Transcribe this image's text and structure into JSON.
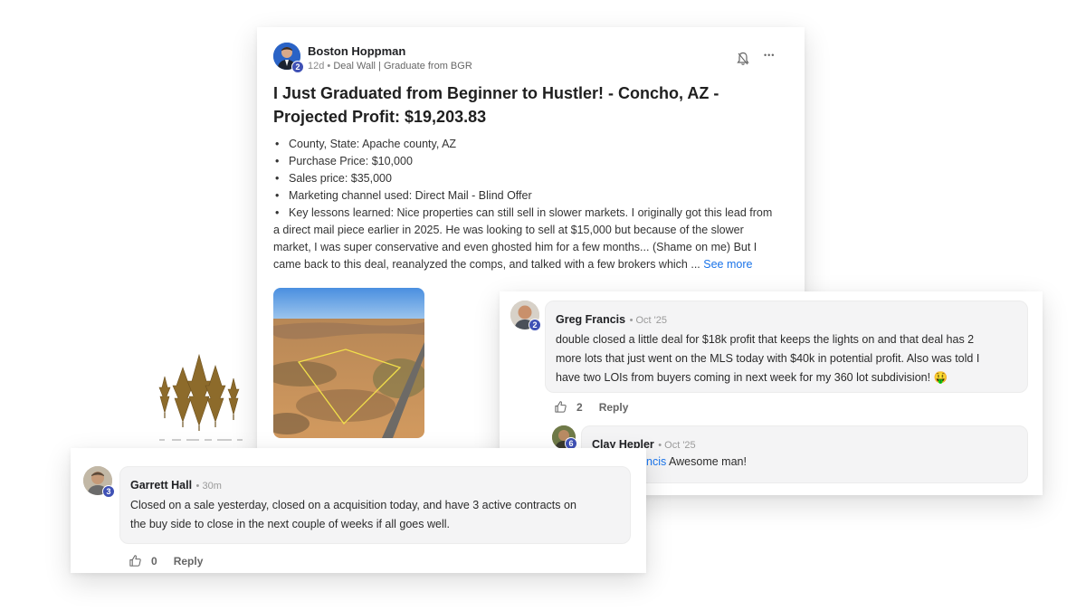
{
  "post": {
    "author": "Boston Hoppman",
    "author_level": "2",
    "age": "12d",
    "category": "Deal Wall | Graduate from BGR",
    "title": "I Just Graduated from Beginner to Hustler! - Concho, AZ - Projected Profit: $19,203.83",
    "bullets": [
      "County, State: Apache county, AZ",
      "Purchase Price: $10,000",
      "Sales price: $35,000",
      "Marketing channel used: Direct Mail - Blind Offer",
      "Key lessons learned: Nice properties can still sell in slower markets. I originally got this lead from"
    ],
    "body_continuation": [
      "a direct mail piece earlier in 2025. He was looking to sell at $15,000 but because of the slower",
      "market, I was super conservative and even ghosted him for a few months... (Shame on me) But I",
      "came back to this deal, reanalyzed the comps, and talked with a few brokers which ..."
    ],
    "see_more": "See more",
    "bell_icon": "bell-icon",
    "more_icon": "more-options-icon",
    "more_glyph": "•••"
  },
  "comments": {
    "greg": {
      "author": "Greg Francis",
      "level": "2",
      "time": "Oct '25",
      "lines": [
        "double closed a little deal for $18k profit that keeps the lights on and that deal has 2",
        "more lots that just went on the MLS today with $40k in potential profit. Also was told I",
        "have two LOIs from buyers coming in next week for my 360 lot subdivision! 🤑"
      ],
      "likes": "2",
      "reply": "Reply"
    },
    "clay": {
      "author": "Clay Hepler",
      "level": "6",
      "time": "Oct '25",
      "mention": "ncis",
      "text": "Awesome man!"
    },
    "garrett": {
      "author": "Garrett Hall",
      "level": "3",
      "time": "30m",
      "lines": [
        "Closed on a sale yesterday, closed on a acquisition today, and have 3 active contracts on",
        "the buy side to close in the next couple of weeks if all goes well."
      ],
      "likes": "0",
      "reply": "Reply"
    }
  },
  "colors": {
    "accent_blue": "#1a73e8",
    "level_badge": "#3f51b5",
    "bubble_bg": "#f4f4f5",
    "logo_gold": "#8a6a2a"
  }
}
